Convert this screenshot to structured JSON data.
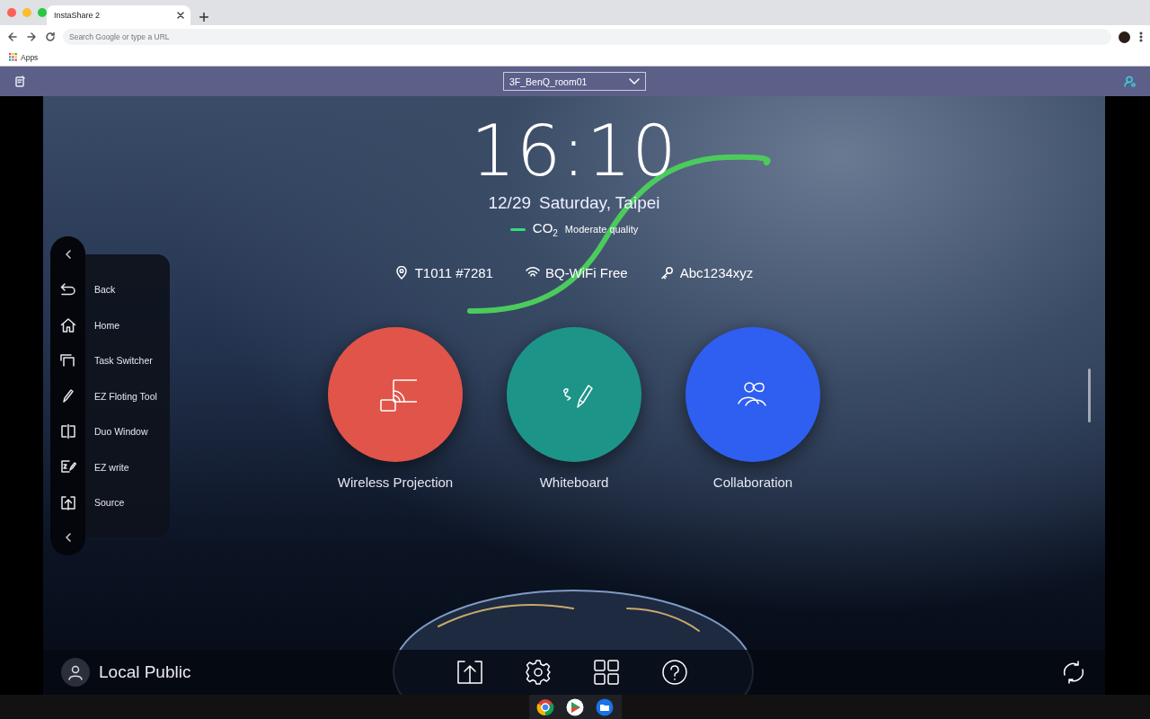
{
  "browser": {
    "tabs": [
      {
        "title": "InstaShare 2",
        "selected": true
      }
    ],
    "address_bar": {
      "placeholder": "Search Google or type a URL"
    },
    "bookmarks": [
      {
        "label": "Apps"
      }
    ]
  },
  "app_header": {
    "room_selector": {
      "value": "3F_BenQ_room01"
    }
  },
  "home": {
    "time": "16:10",
    "date": "12/29",
    "day": "Saturday, Taipei",
    "air_quality": {
      "label": "CO$_{2}$",
      "status": "Moderate quality"
    },
    "info": [
      {
        "kind": "location",
        "text": "T1011 #7281"
      },
      {
        "kind": "wifi",
        "text": "BQ-WiFi Free"
      },
      {
        "kind": "password",
        "text": "Abc1234xyz"
      }
    ],
    "apps": [
      {
        "kind": "projection",
        "label": "Wireless Projection",
        "color": "#e0544a"
      },
      {
        "kind": "whiteboard",
        "label": "Whiteboard",
        "color": "#1d9488"
      },
      {
        "kind": "collaboration",
        "label": "Collaboration",
        "color": "#2f5ff0"
      }
    ]
  },
  "side_menu": {
    "items": [
      {
        "kind": "back",
        "label": "Back"
      },
      {
        "kind": "home",
        "label": "Home"
      },
      {
        "kind": "tasks",
        "label": "Task Switcher"
      },
      {
        "kind": "pen",
        "label": "EZ Floting Tool"
      },
      {
        "kind": "split",
        "label": "Duo Window"
      },
      {
        "kind": "ezwrite",
        "label": "EZ write"
      },
      {
        "kind": "source",
        "label": "Source"
      }
    ]
  },
  "bottom_bar": {
    "user": "Local Public"
  }
}
